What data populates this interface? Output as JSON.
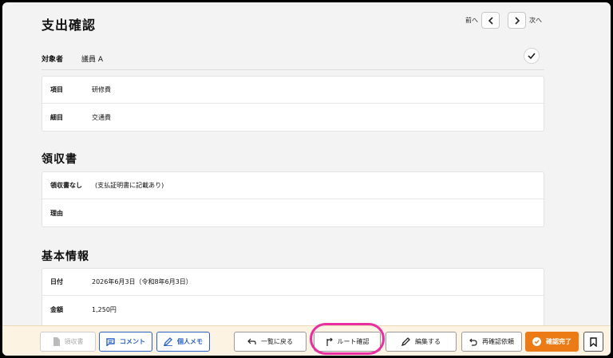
{
  "header": {
    "title": "支出確認",
    "prev_label": "前へ",
    "next_label": "次へ"
  },
  "subject": {
    "label": "対象者",
    "value": "議員 A"
  },
  "details": [
    {
      "label": "項目",
      "value": "研修費"
    },
    {
      "label": "細目",
      "value": "交通費"
    }
  ],
  "receipt": {
    "title": "領収書",
    "rows": [
      {
        "label": "領収書なし",
        "value": "(支払証明書に記載あり)"
      },
      {
        "label": "理由",
        "value": ""
      }
    ]
  },
  "basic_info": {
    "title": "基本情報",
    "rows": [
      {
        "label": "日付",
        "value": "2026年6月3日（令和8年6月3日）"
      },
      {
        "label": "金額",
        "value": "1,250円"
      }
    ]
  },
  "toolbar": {
    "receipt_label": "領収書",
    "comment_label": "コメント",
    "memo_label": "個人メモ",
    "back_label": "一覧に戻る",
    "route_label": "ルート確認",
    "edit_label": "編集する",
    "reconfirm_label": "再確認依頼",
    "complete_label": "確認完了"
  },
  "colors": {
    "accent_blue": "#2b63c7",
    "accent_orange": "#ec7b16",
    "highlight": "#ea2da0",
    "bar_bg": "#fdf3e3"
  }
}
